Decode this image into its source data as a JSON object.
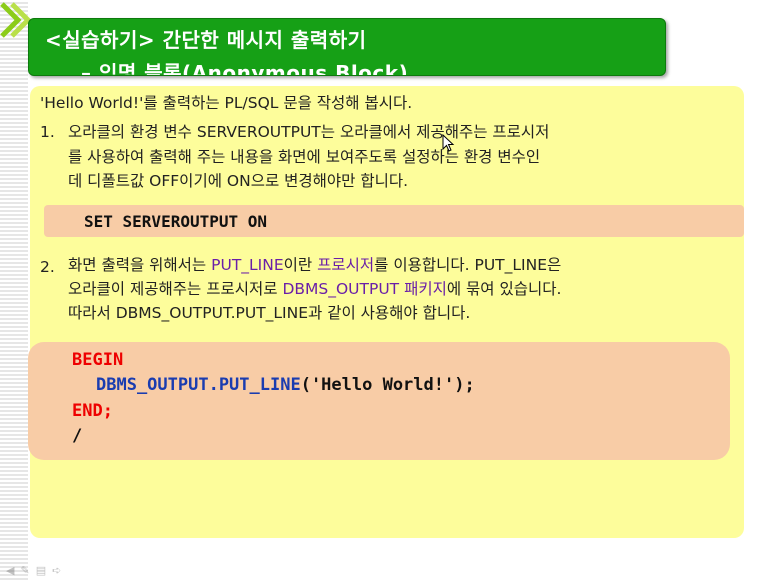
{
  "slide": {
    "title_line1": "<실습하기> 간단한 메시지 출력하기",
    "title_line2": "– 익명 블록(Anonymous Block)"
  },
  "intro": "'Hello World!'를 출력하는 PL/SQL 문을 작성해 봅시다.",
  "step1": {
    "number": "1.",
    "line1": "오라클의 환경 변수 SERVEROUTPUT는 오라클에서 제공해주는 프로시저",
    "line2": "를 사용하여 출력해 주는 내용을 화면에 보여주도록 설정하는 환경 변수인",
    "line3": "데 디폴트값 OFF이기에 ON으로 변경해야만 합니다."
  },
  "set_command": "SET SERVEROUTPUT ON",
  "step2": {
    "number": "2.",
    "l1_a": "화면 출력을 위해서는 ",
    "l1_b": "PUT_LINE",
    "l1_c": "이란 ",
    "l1_d": "프로시저",
    "l1_e": "를 이용합니다. PUT_LINE은",
    "l2_a": "오라클이 제공해주는 프로시저로 ",
    "l2_b": "DBMS_OUTPUT 패키지",
    "l2_c": "에 묶여 있습니다.",
    "line3": "따라서 DBMS_OUTPUT.PUT_LINE과 같이 사용해야 합니다."
  },
  "code": {
    "begin": "BEGIN",
    "call": "DBMS_OUTPUT.PUT_LINE",
    "args": "('Hello World!');",
    "end": "END;",
    "slash": "/"
  },
  "colors": {
    "title_bg": "#16a016",
    "panel_bg": "#fdfd9b",
    "code_bg": "#f8cca6",
    "keyword": "#ee0000",
    "call": "#1a3cb0",
    "highlight": "#6a1fa8"
  },
  "icons": [
    "chevron-decoration-icon",
    "mouse-cursor-icon",
    "slide-nav-icons"
  ]
}
